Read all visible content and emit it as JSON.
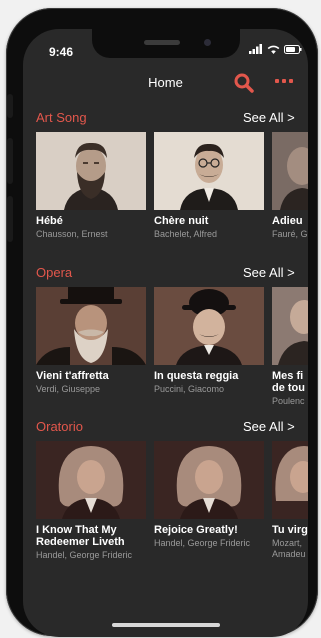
{
  "status_bar": {
    "time": "9:46"
  },
  "nav": {
    "title": "Home"
  },
  "sections": [
    {
      "title": "Art Song",
      "see_all": "See All  >",
      "cards": [
        {
          "title": "Hébé",
          "subtitle": "Chausson, Ernest",
          "portrait": "bearded-man-portrait"
        },
        {
          "title": "Chère nuit",
          "subtitle": "Bachelet, Alfred",
          "portrait": "man-with-glasses-portrait"
        },
        {
          "title": "Adieu",
          "subtitle": "Fauré, G",
          "portrait": "man-portrait"
        }
      ]
    },
    {
      "title": "Opera",
      "see_all": "See All  >",
      "cards": [
        {
          "title": "Vieni t'affretta",
          "subtitle": "Verdi, Giuseppe",
          "portrait": "man-in-top-hat-portrait"
        },
        {
          "title": "In questa reggia",
          "subtitle": "Puccini, Giacomo",
          "portrait": "man-in-bowler-hat-portrait"
        },
        {
          "title": "Mes fi\nde tou",
          "subtitle": "Poulenc",
          "portrait": "man-portrait"
        }
      ]
    },
    {
      "title": "Oratorio",
      "see_all": "See All  >",
      "cards": [
        {
          "title": "I Know That My\nRedeemer Liveth",
          "subtitle": "Handel, George Frideric",
          "portrait": "man-in-wig-portrait"
        },
        {
          "title": "Rejoice Greatly!",
          "subtitle": "Handel, George Frideric",
          "portrait": "man-in-wig-portrait"
        },
        {
          "title": "Tu virg",
          "subtitle": "Mozart,\nAmadeu",
          "portrait": "man-in-wig-portrait"
        }
      ]
    }
  ],
  "colors": {
    "accent": "#e2574c",
    "background": "#292929",
    "text": "#ffffff",
    "muted": "#9a9a9a"
  }
}
